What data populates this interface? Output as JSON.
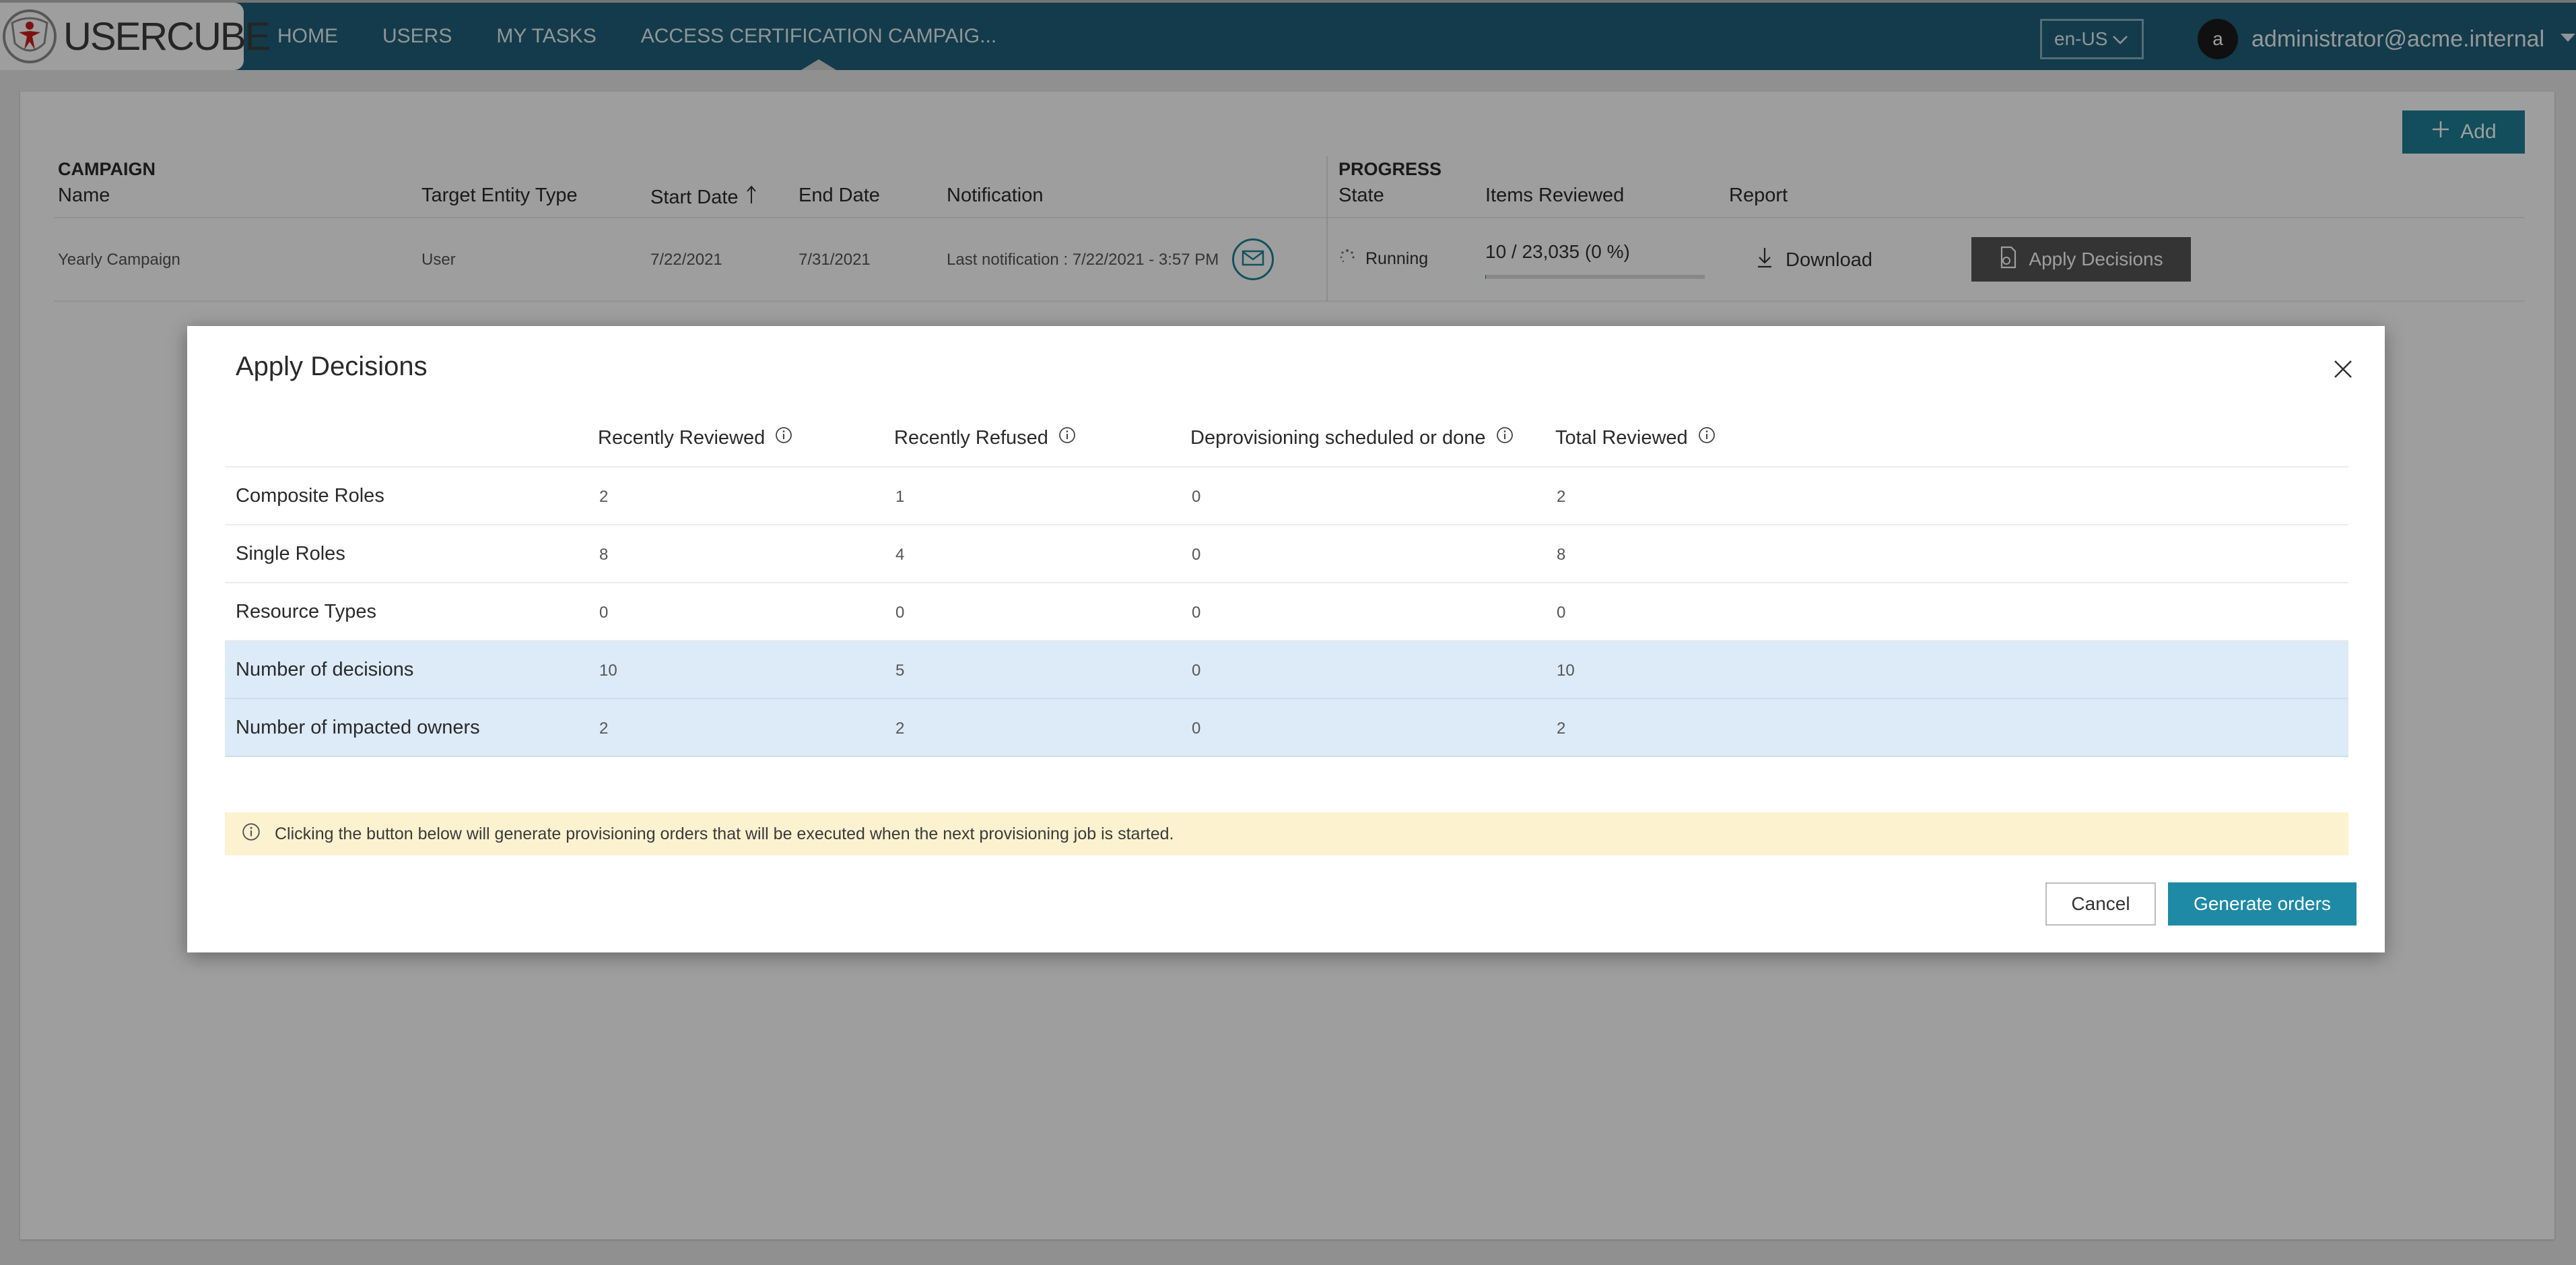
{
  "app": {
    "logo_text": "USERCUBE"
  },
  "nav": {
    "items": [
      {
        "label": "HOME"
      },
      {
        "label": "USERS"
      },
      {
        "label": "MY TASKS"
      },
      {
        "label": "ACCESS CERTIFICATION CAMPAIG..."
      }
    ],
    "active": "ACCESS CERTIFICATION CAMPAIG...",
    "language": "en-US",
    "user_initial": "a",
    "user_name": "administrator@acme.internal"
  },
  "page": {
    "add_label": "Add",
    "group_campaign": "CAMPAIGN",
    "group_progress": "PROGRESS",
    "columns": {
      "name": "Name",
      "target": "Target Entity Type",
      "start": "Start Date",
      "end": "End Date",
      "notification": "Notification",
      "state": "State",
      "items": "Items Reviewed",
      "report": "Report"
    },
    "row": {
      "name": "Yearly Campaign",
      "target": "User",
      "start": "7/22/2021",
      "end": "7/31/2021",
      "notification": "Last notification : 7/22/2021 - 3:57 PM",
      "state": "Running",
      "items_reviewed": "10 / 23,035 (0 %)",
      "progress_fraction": 0.0004,
      "download_label": "Download",
      "apply_label": "Apply Decisions"
    }
  },
  "modal": {
    "title": "Apply Decisions",
    "headers": [
      "Recently Reviewed",
      "Recently Refused",
      "Deprovisioning scheduled or done",
      "Total Reviewed"
    ],
    "rows": [
      {
        "label": "Composite Roles",
        "values": [
          "2",
          "1",
          "0",
          "2"
        ]
      },
      {
        "label": "Single Roles",
        "values": [
          "8",
          "4",
          "0",
          "8"
        ]
      },
      {
        "label": "Resource Types",
        "values": [
          "0",
          "0",
          "0",
          "0"
        ]
      },
      {
        "label": "Number of decisions",
        "values": [
          "10",
          "5",
          "0",
          "10"
        ]
      },
      {
        "label": "Number of impacted owners",
        "values": [
          "2",
          "2",
          "0",
          "2"
        ]
      }
    ],
    "notice": "Clicking the button below will generate provisioning orders that will be executed when the next provisioning job is started.",
    "cancel_label": "Cancel",
    "generate_label": "Generate orders"
  },
  "colors": {
    "topbar": "#20607a",
    "accent": "#1e8aa6",
    "highlight_row": "#ddeaf7",
    "notice_bg": "#fdf2d0"
  }
}
